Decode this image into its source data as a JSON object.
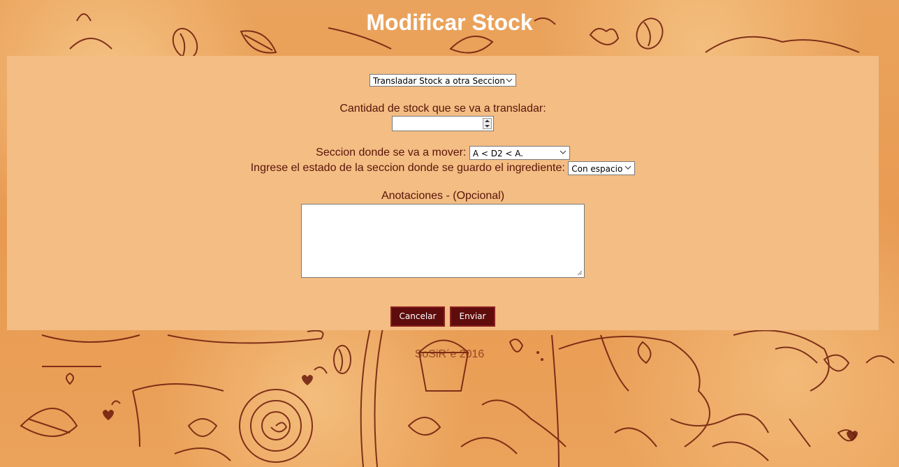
{
  "page": {
    "title": "Modificar Stock",
    "footer": "SoSiR´e 2016"
  },
  "form": {
    "action_select": {
      "value": "Transladar Stock a otra Seccion"
    },
    "quantity": {
      "label": "Cantidad de stock que se va a transladar:",
      "value": ""
    },
    "section": {
      "label": "Seccion donde se va a mover:",
      "value": "A < D2 < A."
    },
    "state": {
      "label": "Ingrese el estado de la seccion donde se guardo el ingrediente:",
      "value": "Con espacio"
    },
    "notes": {
      "label": "Anotaciones - (Opcional)",
      "value": ""
    },
    "cancel_label": "Cancelar",
    "submit_label": "Enviar"
  },
  "colors": {
    "background": "#e89a52",
    "panel": "#f3bd84",
    "label_text": "#5a1408",
    "button_bg": "#5e0c0c",
    "doodle": "#6b1a0a"
  },
  "icons": {
    "dropdown": "chevron-down-icon",
    "spinner": "spinner-arrows-icon",
    "resize": "resize-grip-icon"
  }
}
